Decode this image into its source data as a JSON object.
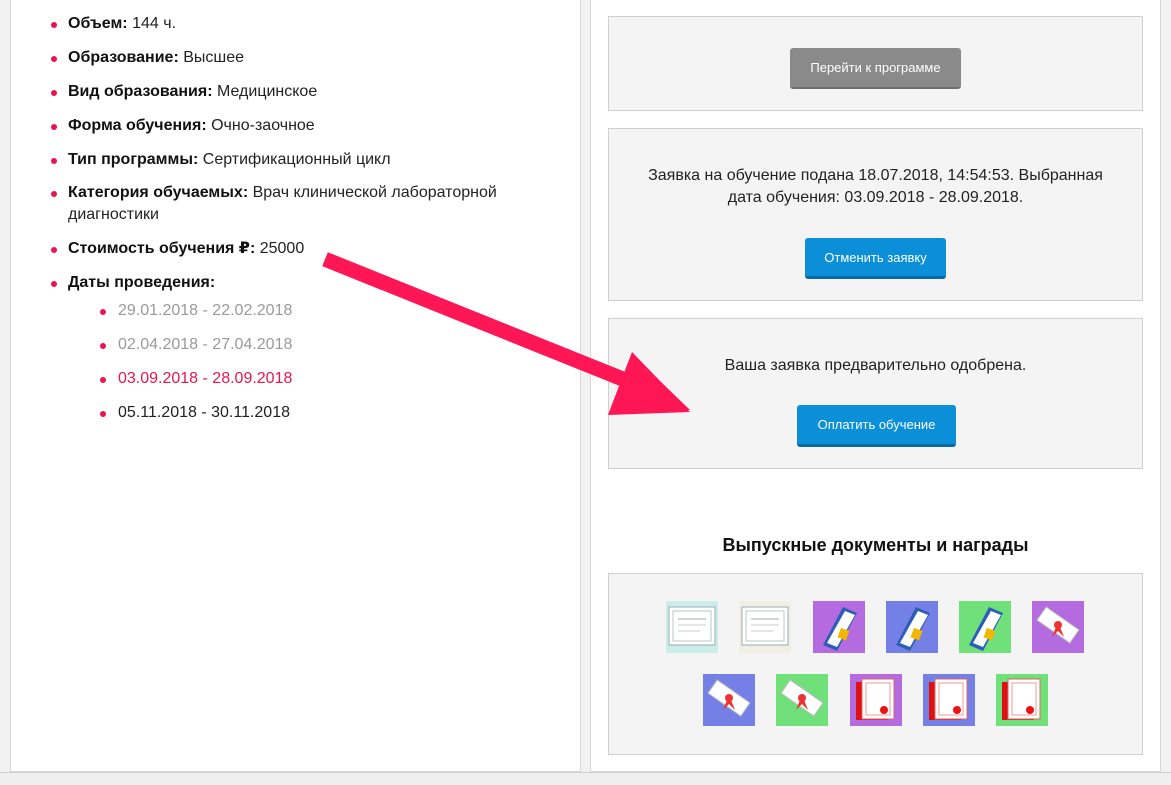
{
  "program_info": {
    "items": [
      {
        "label": "Объем:",
        "value": "144 ч."
      },
      {
        "label": "Образование:",
        "value": "Высшее"
      },
      {
        "label": "Вид образования:",
        "value": "Медицинское"
      },
      {
        "label": "Форма обучения:",
        "value": "Очно-заочное"
      },
      {
        "label": "Тип программы:",
        "value": "Сертификационный цикл"
      },
      {
        "label": "Категория обучаемых:",
        "value": "Врач клинической лабораторной диагностики"
      },
      {
        "label": "Стоимость обучения ₽:",
        "value": "25000"
      },
      {
        "label": "Даты проведения:",
        "value": ""
      }
    ],
    "dates": [
      {
        "text": "29.01.2018 - 22.02.2018",
        "status": "past"
      },
      {
        "text": "02.04.2018 - 27.04.2018",
        "status": "past"
      },
      {
        "text": "03.09.2018 - 28.09.2018",
        "status": "selected"
      },
      {
        "text": "05.11.2018 - 30.11.2018",
        "status": "future"
      }
    ]
  },
  "program_panel": {
    "button_label": "Перейти к программе"
  },
  "application_panel": {
    "text": "Заявка на обучение подана 18.07.2018, 14:54:53. Выбранная дата обучения: 03.09.2018 - 28.09.2018.",
    "button_label": "Отменить заявку"
  },
  "approval_panel": {
    "text": "Ваша заявка предварительно одобрена.",
    "button_label": "Оплатить обучение"
  },
  "awards_section": {
    "title": "Выпускные документы и награды",
    "awards": [
      {
        "icon": "diploma-green-icon",
        "bg": "#cdeee6"
      },
      {
        "icon": "certificate-beige-icon",
        "bg": "#f1efe4"
      },
      {
        "icon": "booklet-purple-icon",
        "bg": "#b56be0"
      },
      {
        "icon": "booklet-blue-icon",
        "bg": "#7580e6"
      },
      {
        "icon": "booklet-green-icon",
        "bg": "#6fe07a"
      },
      {
        "icon": "scroll-purple-icon",
        "bg": "#b56be0"
      },
      {
        "icon": "scroll-blue-icon",
        "bg": "#7580e6"
      },
      {
        "icon": "scroll-green-icon",
        "bg": "#6fe07a"
      },
      {
        "icon": "certificate-purple-icon",
        "bg": "#b56be0"
      },
      {
        "icon": "certificate-blue-icon",
        "bg": "#7580e6"
      },
      {
        "icon": "certificate-green-icon",
        "bg": "#6fe07a"
      }
    ]
  },
  "colors": {
    "accent": "#e8154f",
    "button_blue": "#0b8fd9",
    "button_gray": "#8a8a8a"
  }
}
